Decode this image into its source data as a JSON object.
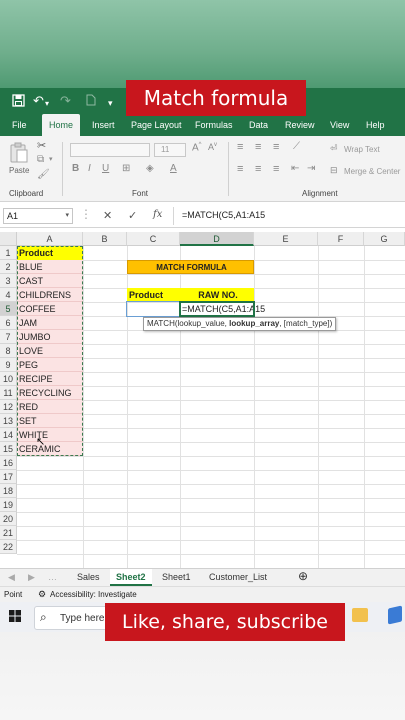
{
  "captions": {
    "top": "Match  formula",
    "bottom": "Like, share, subscribe"
  },
  "tabs": [
    "File",
    "Home",
    "Insert",
    "Page Layout",
    "Formulas",
    "Data",
    "Review",
    "View",
    "Help"
  ],
  "ribbon": {
    "paste": "Paste",
    "clipboard": "Clipboard",
    "font_size": "11",
    "font": "Font",
    "wrap_text": "Wrap Text",
    "merge_center": "Merge & Center",
    "alignment": "Alignment"
  },
  "formula_bar": {
    "name_box": "A1",
    "fx": "fx",
    "formula": "=MATCH(C5,A1:A15"
  },
  "columns": [
    "A",
    "B",
    "C",
    "D",
    "E",
    "F",
    "G"
  ],
  "rows": [
    "1",
    "2",
    "3",
    "4",
    "5",
    "6",
    "7",
    "8",
    "9",
    "10",
    "11",
    "12",
    "13",
    "14",
    "15",
    "16",
    "17",
    "18",
    "19",
    "20",
    "21",
    "22"
  ],
  "column_a": [
    "Product",
    "BLUE",
    "CAST",
    "CHILDRENS",
    "COFFEE",
    "JAM",
    "JUMBO",
    "LOVE",
    "PEG",
    "RECIPE",
    "RECYCLING",
    "RED",
    "SET",
    "WHITE",
    "CERAMIC"
  ],
  "match_title": "MATCH FORMULA",
  "c4": "Product",
  "d4": "RAW NO.",
  "d5": "=MATCH(C5,A1:A15",
  "tooltip": {
    "fn": "MATCH(",
    "arg1": "lookup_value, ",
    "arg2": "lookup_array",
    "arg3": ", [match_type])"
  },
  "sheets": [
    "Sales",
    "Sheet2",
    "Sheet1",
    "Customer_List"
  ],
  "status": {
    "mode": "Point",
    "accessibility": "Accessibility: Investigate"
  },
  "taskbar": {
    "search": "Type here"
  },
  "colors": {
    "excel_green": "#217346",
    "header_yellow": "#ffff00",
    "title_orange": "#ffc000",
    "caption_red": "#c8161d",
    "list_pink": "#fbe3e3"
  }
}
